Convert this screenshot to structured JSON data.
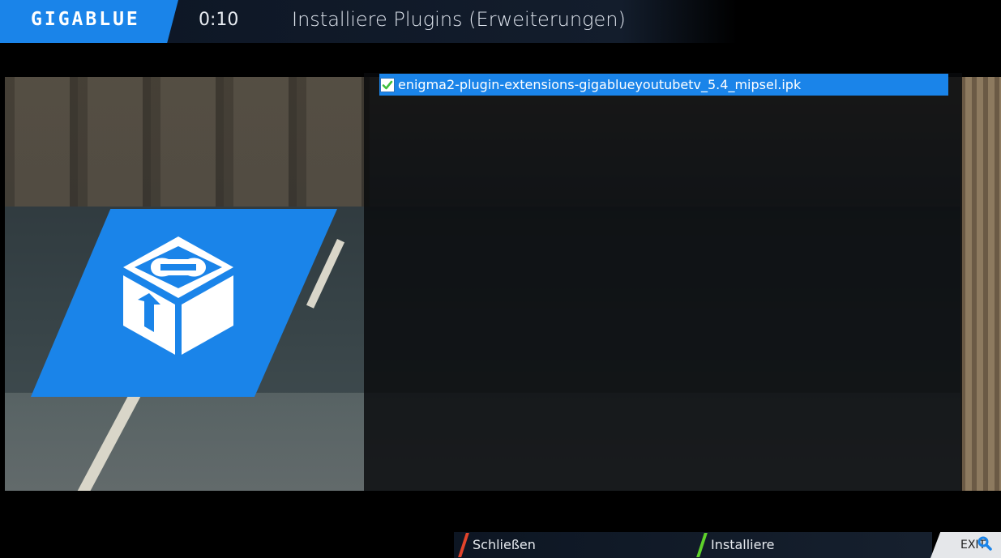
{
  "header": {
    "logo": "GIGABLUE",
    "clock": "0:10",
    "title": "Installiere Plugins (Erweiterungen)"
  },
  "plugin_list": {
    "items": [
      {
        "label": "enigma2-plugin-extensions-gigablueyoutubetv_5.4_mipsel.ipk",
        "checked": true
      }
    ]
  },
  "footer": {
    "red_key_label": "Schließen",
    "green_key_label": "Installiere",
    "exit_label": "EXIT"
  },
  "colors": {
    "accent": "#1a84e9",
    "red_key": "#e2442b",
    "green_key": "#5fd22b",
    "check": "#3fbf3f"
  },
  "icons": {
    "plugin": "plugin-box-icon",
    "check": "checkbox-checked-icon",
    "exit": "search-icon"
  }
}
